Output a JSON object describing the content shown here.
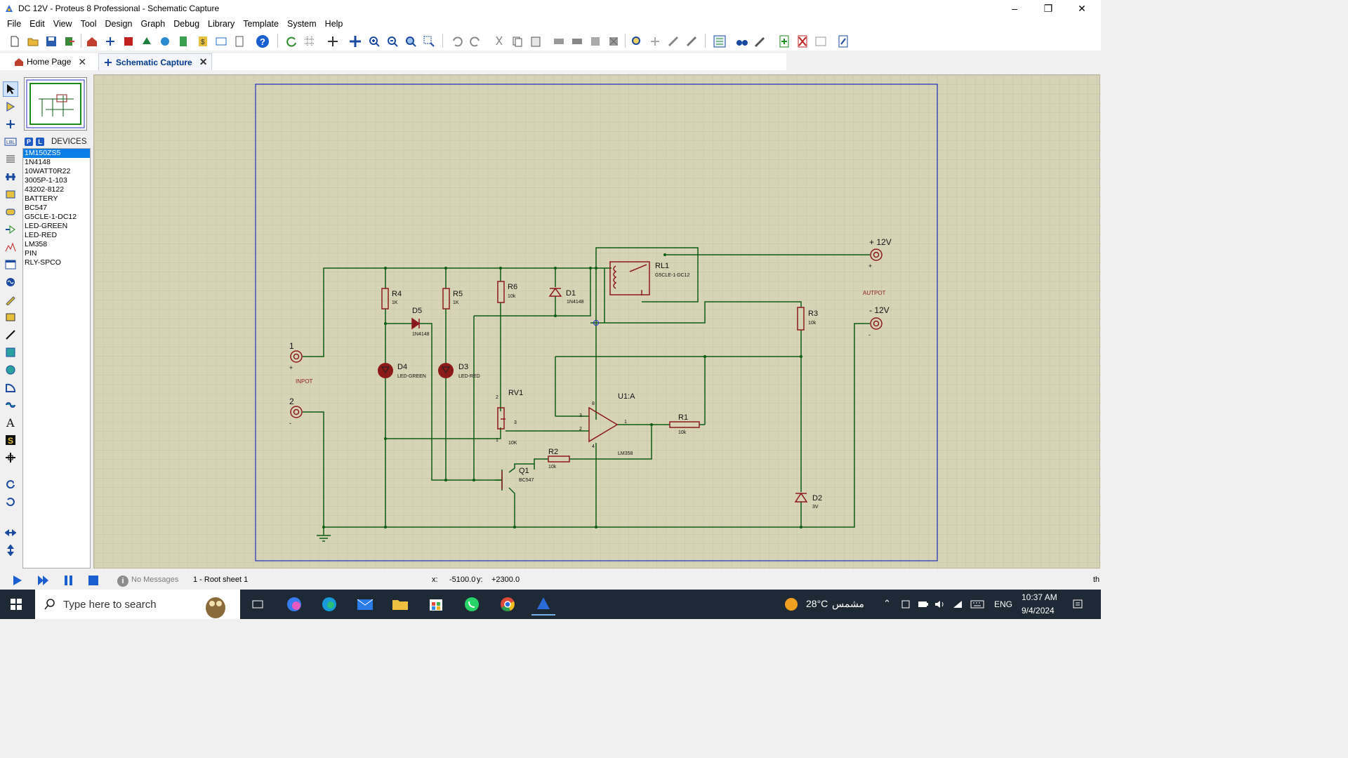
{
  "window": {
    "title": "DC 12V - Proteus 8 Professional - Schematic Capture"
  },
  "menu": [
    "File",
    "Edit",
    "View",
    "Tool",
    "Design",
    "Graph",
    "Debug",
    "Library",
    "Template",
    "System",
    "Help"
  ],
  "tabs": [
    {
      "label": "Home Page"
    },
    {
      "label": "Schematic Capture"
    }
  ],
  "devices": {
    "header": "DEVICES",
    "buttons": [
      "P",
      "L"
    ],
    "items": [
      "1M150ZS5",
      "1N4148",
      "10WATT0R22",
      "3005P-1-103",
      "43202-8122",
      "BATTERY",
      "BC547",
      "G5CLE-1-DC12",
      "LED-GREEN",
      "LED-RED",
      "LM358",
      "PIN",
      "RLY-SPCO"
    ],
    "selected": "1M150ZS5"
  },
  "rotation": "0°",
  "schematic": {
    "labels": {
      "pin1_num": "1",
      "pin2_num": "2",
      "pin1_plus": "+",
      "pin2_minus": "-",
      "input": "INPOT",
      "output": "AUTPOT",
      "plus12": "+ 12V",
      "minus12": "- 12V",
      "plus_sign": "+",
      "minus_sign": "-",
      "R4": "R4",
      "R4v": "1K",
      "R5": "R5",
      "R5v": "1K",
      "R6": "R6",
      "R6v": "10k",
      "D1": "D1",
      "D1v": "1N4148",
      "D5": "D5",
      "D5v": "1N4148",
      "D4": "D4",
      "D4v": "LED-GREEN",
      "D3": "D3",
      "D3v": "LED-RED",
      "RL1": "RL1",
      "RL1v": "G5CLE-1-DC12",
      "R3": "R3",
      "R3v": "10k",
      "RV1": "RV1",
      "RV1v": "10K",
      "U1": "U1:A",
      "U1v": "LM358",
      "R1": "R1",
      "R1v": "10k",
      "R2": "R2",
      "R2v": "10k",
      "Q1": "Q1",
      "Q1v": "BC547",
      "D2": "D2",
      "D2v": "3V",
      "op_pin3": "3",
      "op_pin2": "2",
      "op_pin1": "1",
      "op_pin8": "8",
      "op_pin4": "4",
      "rv_pin3": "3",
      "rv_pin2": "2",
      "rv_pin1": "1"
    }
  },
  "status": {
    "messages": "No Messages",
    "sheet": "1 - Root sheet 1",
    "x_label": "x:",
    "x_value": "-5100.0",
    "y_label": "y:",
    "y_value": "+2300.0",
    "right": "th"
  },
  "taskbar": {
    "search_placeholder": "Type here to search",
    "weather_temp": "28°C",
    "weather_desc": "مشمس",
    "language": "ENG",
    "time": "10:37 AM",
    "date": "9/4/2024"
  },
  "colors": {
    "wire": "#0a5d14",
    "component": "#8b1a1a",
    "sheet_bg": "#d7d3b6",
    "grid": "#c9c5a8",
    "border": "#1f2fbd",
    "selection": "#0a7de6"
  }
}
